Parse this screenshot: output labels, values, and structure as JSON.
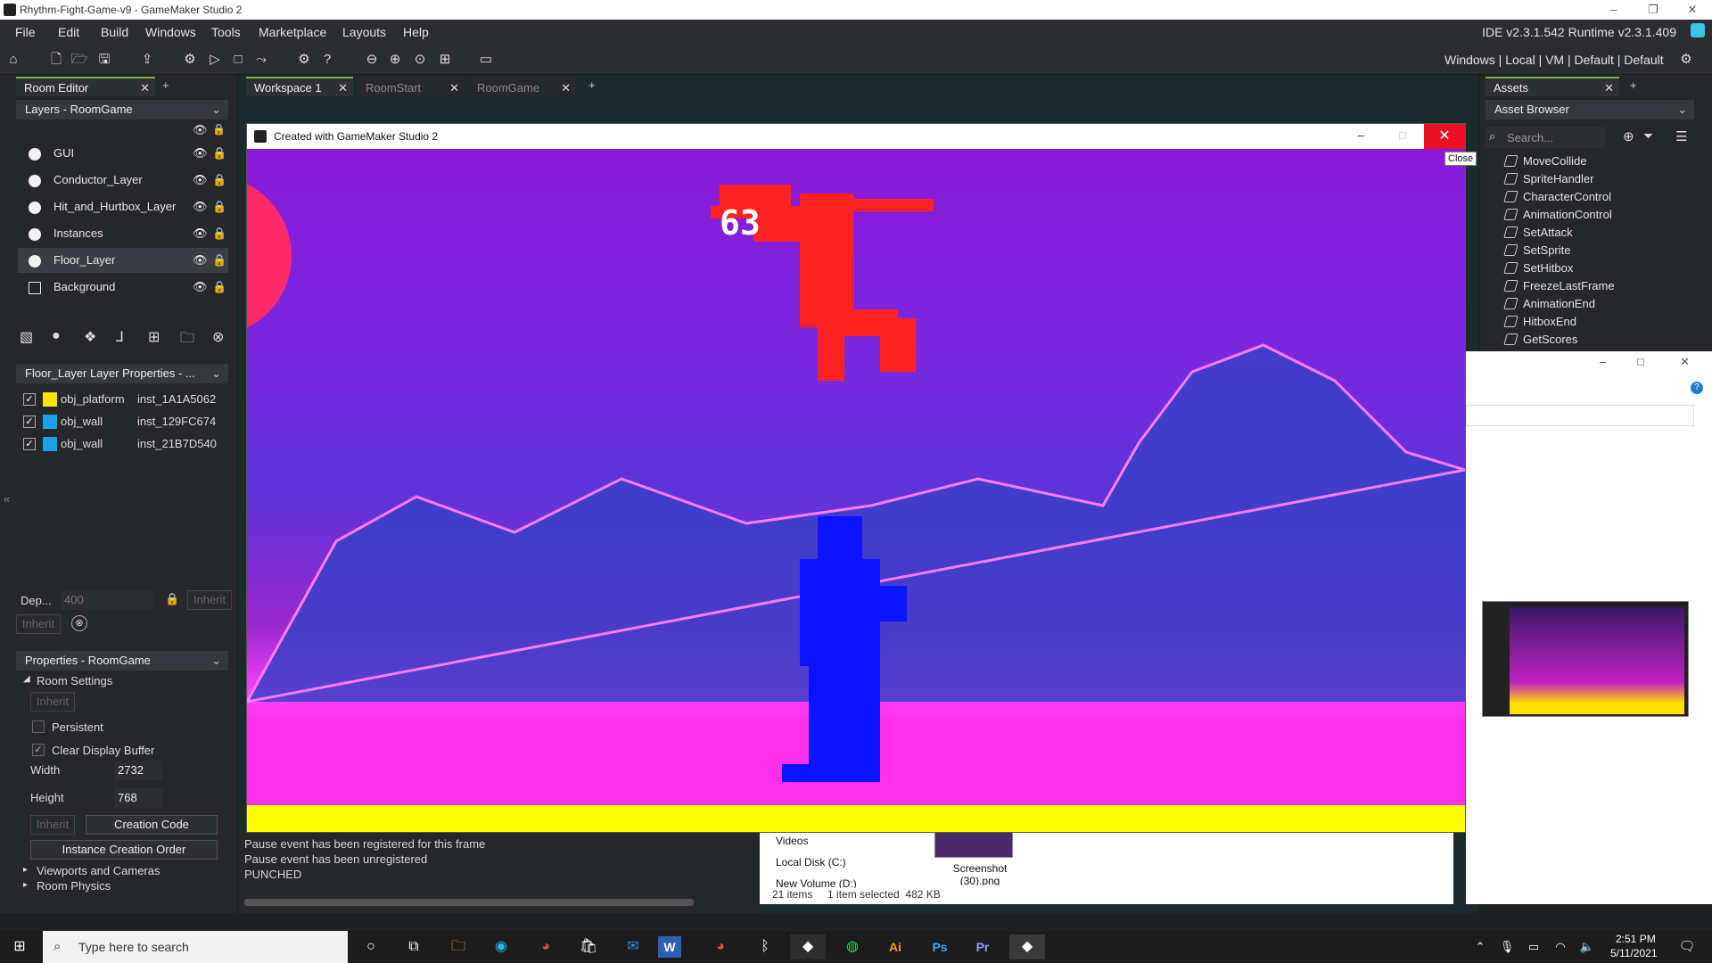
{
  "window": {
    "title": "Rhythm-Fight-Game-v9 - GameMaker Studio 2",
    "controls": [
      "–",
      "❐",
      "✕"
    ]
  },
  "menu": {
    "items": [
      "File",
      "Edit",
      "Build",
      "Windows",
      "Tools",
      "Marketplace",
      "Layouts",
      "Help"
    ],
    "version": "IDE v2.3.1.542  Runtime v2.3.1.409"
  },
  "toolbar": {
    "targets": "Windows | Local | VM | Default | Default"
  },
  "left_panel": {
    "tab": "Room Editor",
    "layers_header": "Layers - RoomGame",
    "layers": [
      "GUI",
      "Conductor_Layer",
      "Hit_and_Hurtbox_Layer",
      "Instances",
      "Floor_Layer",
      "Background"
    ],
    "layer_props_header": "Floor_Layer Layer Properties - ...",
    "instances": [
      {
        "object": "obj_platform",
        "id": "inst_1A1A5062",
        "color": "#f5e600"
      },
      {
        "object": "obj_wall",
        "id": "inst_129FC674",
        "color": "#19a3e6"
      },
      {
        "object": "obj_wall",
        "id": "inst_21B7D540",
        "color": "#19a3e6"
      }
    ],
    "depth_label": "Dep...",
    "depth_value": "400",
    "inherit": "Inherit",
    "props_header": "Properties - RoomGame",
    "room_settings": "Room Settings",
    "persistent": "Persistent",
    "clear_display": "Clear Display Buffer",
    "width_label": "Width",
    "width_value": "2732",
    "height_label": "Height",
    "height_value": "768",
    "creation_code": "Creation Code",
    "instance_order": "Instance Creation Order",
    "viewports": "Viewports and Cameras",
    "room_physics": "Room Physics"
  },
  "workspace": {
    "tabs": [
      "Workspace 1",
      "RoomStart",
      "RoomGame"
    ]
  },
  "game_window": {
    "title": "Created with GameMaker Studio 2",
    "score": "63",
    "tooltip": "Close"
  },
  "console": {
    "lines": [
      "Pause event has been registered for this frame",
      "Pause event has been unregistered",
      "PUNCHED"
    ]
  },
  "explorer": {
    "nav": [
      "Videos",
      "Local Disk (C:)",
      "New Volume (D:)"
    ],
    "thumb_label": "Screenshot (30).png",
    "status": "21 items     1 item selected  482 KB"
  },
  "assets": {
    "tab": "Assets",
    "header": "Asset Browser",
    "search_placeholder": "Search...",
    "items": [
      "MoveCollide",
      "SpriteHandler",
      "CharacterControl",
      "AnimationControl",
      "SetAttack",
      "SetSprite",
      "SetHitbox",
      "FreezeLastFrame",
      "AnimationEnd",
      "HitboxEnd",
      "GetScores"
    ]
  },
  "taskbar": {
    "search": "Type here to search",
    "time": "2:51 PM",
    "date": "5/11/2021",
    "apps": [
      "cortana-icon",
      "taskview-icon",
      "explorer-icon",
      "edge-icon",
      "chrome-icon",
      "store-icon",
      "mail-icon",
      "word-icon",
      "chrome2-icon",
      "b-icon",
      "gamemaker-icon",
      "spotify-icon",
      "illustrator-icon",
      "photoshop-icon",
      "premiere-icon",
      "gamemaker-run-icon"
    ],
    "ai_label": "Ai",
    "ps_label": "Ps",
    "pr_label": "Pr",
    "w_label": "W"
  }
}
